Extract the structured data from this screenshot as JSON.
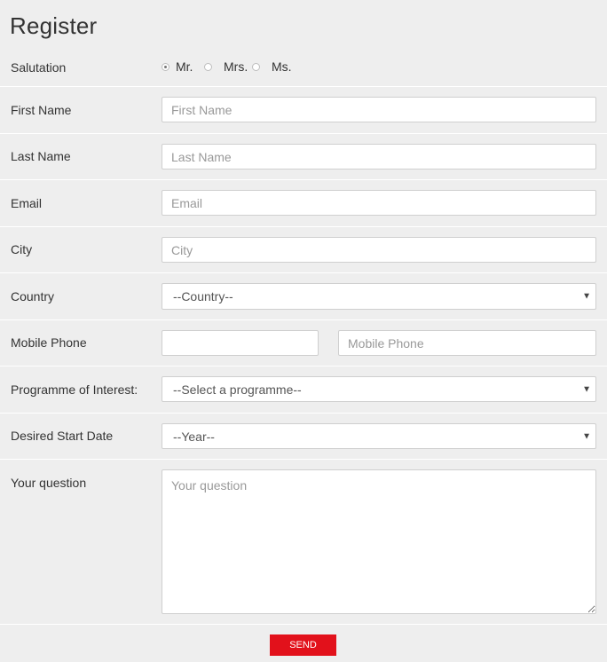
{
  "form": {
    "title": "Register",
    "salutation": {
      "label": "Salutation",
      "options": [
        "Mr.",
        "Mrs.",
        "Ms."
      ],
      "selected": "Mr."
    },
    "first_name": {
      "label": "First Name",
      "placeholder": "First Name",
      "value": ""
    },
    "last_name": {
      "label": "Last Name",
      "placeholder": "Last Name",
      "value": ""
    },
    "email": {
      "label": "Email",
      "placeholder": "Email",
      "value": ""
    },
    "city": {
      "label": "City",
      "placeholder": "City",
      "value": ""
    },
    "country": {
      "label": "Country",
      "selected": "--Country--"
    },
    "mobile_phone": {
      "label": "Mobile Phone",
      "prefix_value": "",
      "placeholder": "Mobile Phone",
      "value": ""
    },
    "programme": {
      "label": "Programme of Interest:",
      "selected": "--Select a programme--"
    },
    "start_date": {
      "label": "Desired Start Date",
      "selected": "--Year--"
    },
    "question": {
      "label": "Your question",
      "placeholder": "Your question",
      "value": ""
    },
    "send_label": "SEND"
  },
  "colors": {
    "background": "#eeeeee",
    "send_button": "#e2111b",
    "divider": "#ffffff"
  },
  "icons": {
    "select_arrow": "triangle-down-icon"
  }
}
